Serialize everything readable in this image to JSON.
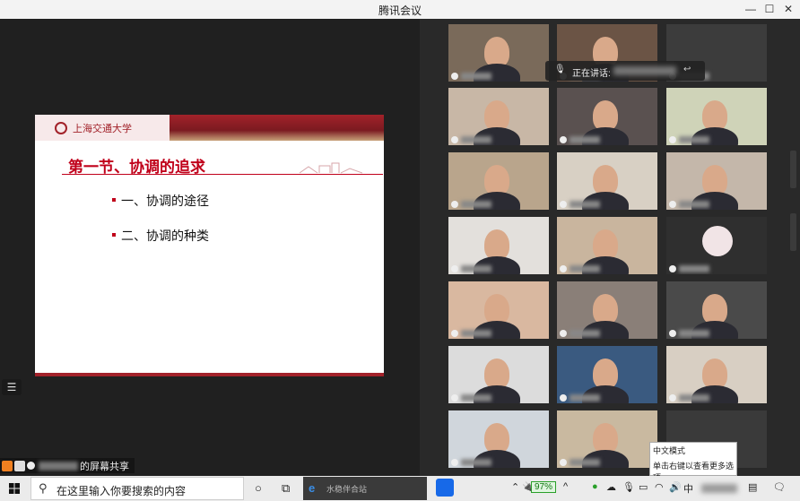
{
  "window": {
    "title": "腾讯会议",
    "controls": [
      "—",
      "☐",
      "✕"
    ]
  },
  "slide": {
    "university": "上海交通大学",
    "title": "第一节、协调的追求",
    "bullets": [
      "一、协调的途径",
      "二、协调的种类"
    ]
  },
  "presenter": {
    "status": "的屏幕共享"
  },
  "speaking": {
    "label": "正在讲话:"
  },
  "ime_popup": {
    "line1": "中文模式",
    "line2": "单击右键以查看更多选项"
  },
  "taskbar": {
    "search_placeholder": "在这里输入你要搜索的内容",
    "browser_tab": "水稳伴合站",
    "battery": "97%",
    "ime_char": "中"
  },
  "icons": {
    "minimize": "minimize-icon",
    "maximize": "maximize-icon",
    "close": "close-icon",
    "list": "list-icon",
    "mic": "mic-icon",
    "windows": "windows-logo-icon",
    "search": "search-icon",
    "cortana": "cortana-circle-icon",
    "task_view": "task-view-icon"
  },
  "colors": {
    "brand_red": "#c0001a",
    "battery_green": "#2aa02a",
    "speaking_green": "#28c840"
  }
}
